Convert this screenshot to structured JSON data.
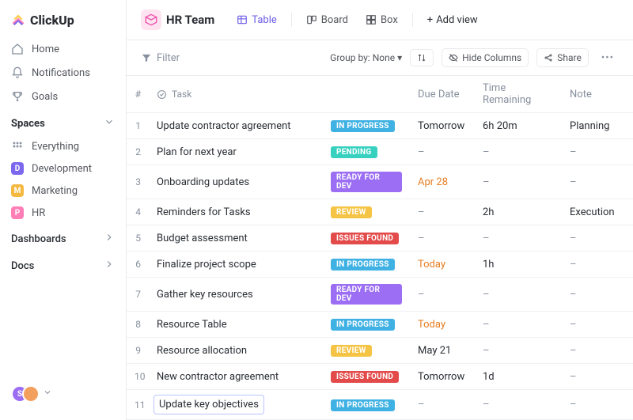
{
  "brand": "ClickUp",
  "nav": {
    "home": "Home",
    "notifications": "Notifications",
    "goals": "Goals"
  },
  "spaces": {
    "header": "Spaces",
    "everything": "Everything",
    "items": [
      {
        "initial": "D",
        "label": "Development",
        "color": "#7b68ee"
      },
      {
        "initial": "M",
        "label": "Marketing",
        "color": "#f5b942"
      },
      {
        "initial": "P",
        "label": "HR",
        "color": "#ff7eb6"
      }
    ]
  },
  "side_sections": {
    "dashboards": "Dashboards",
    "docs": "Docs"
  },
  "header": {
    "space_name": "HR Team",
    "views": {
      "table": "Table",
      "board": "Board",
      "box": "Box",
      "add": "Add view"
    }
  },
  "toolbar": {
    "filter": "Filter",
    "group_by_label": "Group by:",
    "group_by_value": "None",
    "hide_columns": "Hide Columns",
    "share": "Share"
  },
  "columns": {
    "num": "#",
    "task": "Task",
    "due": "Due Date",
    "time": "Time Remaining",
    "note": "Note"
  },
  "status_styles": {
    "IN PROGRESS": "#3fb1e3",
    "PENDING": "#38d1c0",
    "READY FOR DEV": "#9b6ef3",
    "REVIEW": "#f5c445",
    "ISSUES FOUND": "#e34b4b"
  },
  "rows": [
    {
      "n": 1,
      "task": "Update contractor agreement",
      "status": "IN PROGRESS",
      "due": "Tomorrow",
      "due_warn": false,
      "time": "6h 20m",
      "note": "Planning"
    },
    {
      "n": 2,
      "task": "Plan for next year",
      "status": "PENDING",
      "due": "–",
      "due_warn": false,
      "time": "–",
      "note": "–"
    },
    {
      "n": 3,
      "task": "Onboarding updates",
      "status": "READY FOR DEV",
      "due": "Apr 28",
      "due_warn": true,
      "time": "–",
      "note": "–"
    },
    {
      "n": 4,
      "task": "Reminders for Tasks",
      "status": "REVIEW",
      "due": "–",
      "due_warn": false,
      "time": "2h",
      "note": "Execution"
    },
    {
      "n": 5,
      "task": "Budget assessment",
      "status": "ISSUES FOUND",
      "due": "–",
      "due_warn": false,
      "time": "–",
      "note": "–"
    },
    {
      "n": 6,
      "task": "Finalize project scope",
      "status": "IN PROGRESS",
      "due": "Today",
      "due_warn": true,
      "time": "1h",
      "note": "–"
    },
    {
      "n": 7,
      "task": "Gather key resources",
      "status": "READY FOR DEV",
      "due": "–",
      "due_warn": false,
      "time": "–",
      "note": "–"
    },
    {
      "n": 8,
      "task": "Resource Table",
      "status": "IN PROGRESS",
      "due": "Today",
      "due_warn": true,
      "time": "–",
      "note": "–"
    },
    {
      "n": 9,
      "task": "Resource allocation",
      "status": "REVIEW",
      "due": "May 21",
      "due_warn": false,
      "time": "–",
      "note": "–"
    },
    {
      "n": 10,
      "task": "New contractor agreement",
      "status": "ISSUES FOUND",
      "due": "Tomorrow",
      "due_warn": false,
      "time": "1d",
      "note": "–"
    },
    {
      "n": 11,
      "task": "Update key objectives",
      "status": "IN PROGRESS",
      "due": "–",
      "due_warn": false,
      "time": "–",
      "note": "–",
      "editing": true
    }
  ]
}
